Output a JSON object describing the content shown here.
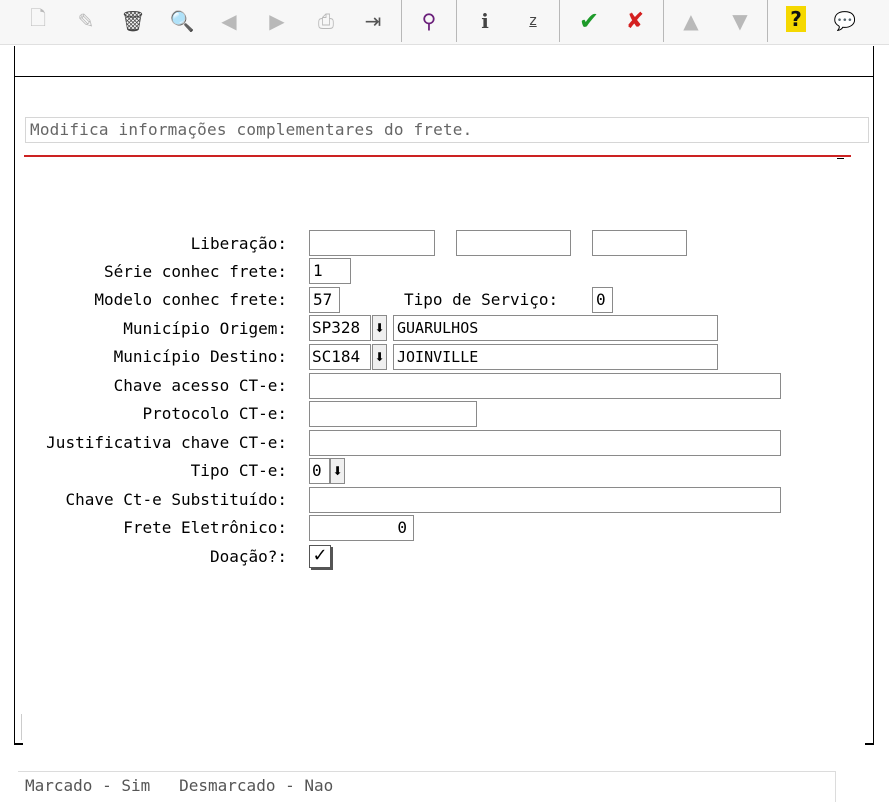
{
  "toolbar": {
    "buttons": [
      {
        "name": "new-document-icon",
        "glyph": "🗋",
        "enabled": false
      },
      {
        "name": "edit-icon",
        "glyph": "✎",
        "enabled": false
      },
      {
        "name": "delete-icon",
        "glyph": "🗑",
        "enabled": true
      },
      {
        "name": "search-icon",
        "glyph": "🔍",
        "enabled": true
      },
      {
        "name": "previous-icon",
        "glyph": "◀",
        "enabled": false
      },
      {
        "name": "next-icon",
        "glyph": "▶",
        "enabled": false
      },
      {
        "name": "print-icon",
        "glyph": "⎙",
        "enabled": false
      },
      {
        "name": "exit-icon",
        "glyph": "⇥",
        "enabled": true
      },
      {
        "name": "binoculars-icon",
        "glyph": "⚲",
        "enabled": true
      },
      {
        "name": "info-icon",
        "glyph": "i",
        "enabled": true
      },
      {
        "name": "sort-icon",
        "glyph": "z",
        "enabled": true
      },
      {
        "name": "confirm-icon",
        "glyph": "✔",
        "enabled": true
      },
      {
        "name": "cancel-icon",
        "glyph": "✘",
        "enabled": true
      },
      {
        "name": "up-icon",
        "glyph": "▲",
        "enabled": false
      },
      {
        "name": "down-icon",
        "glyph": "▼",
        "enabled": false
      },
      {
        "name": "help-icon",
        "glyph": "?",
        "enabled": true
      },
      {
        "name": "comment-icon",
        "glyph": "💬",
        "enabled": true
      }
    ]
  },
  "heading": "Modifica informações complementares do frete.",
  "labels": {
    "liberacao": "Liberação:",
    "serie": "Série conhec frete:",
    "modelo": "Modelo conhec frete:",
    "tipo_servico": "Tipo de Serviço:",
    "municipio_origem": "Município Origem:",
    "municipio_destino": "Município Destino:",
    "chave_acesso": "Chave acesso CT-e:",
    "protocolo": "Protocolo CT-e:",
    "justificativa": "Justificativa chave CT-e:",
    "tipo_cte": "Tipo CT-e:",
    "chave_substituido": "Chave Ct-e Substituído:",
    "frete_eletronico": "Frete Eletrônico:",
    "doacao": "Doação?:"
  },
  "values": {
    "liberacao_1": "",
    "liberacao_2": "",
    "liberacao_3": "",
    "serie": "1",
    "modelo": "57",
    "tipo_servico": "0",
    "origem_codigo": "SP328",
    "origem_nome": "GUARULHOS",
    "destino_codigo": "SC184",
    "destino_nome": "JOINVILLE",
    "chave_acesso": "",
    "protocolo": "",
    "justificativa": "",
    "tipo_cte": "0",
    "chave_substituido": "",
    "frete_eletronico": "0",
    "doacao_checked": true,
    "doacao_mark": "✓",
    "dropdown_glyph": "⬇"
  },
  "status": "Marcado - Sim   Desmarcado - Nao"
}
